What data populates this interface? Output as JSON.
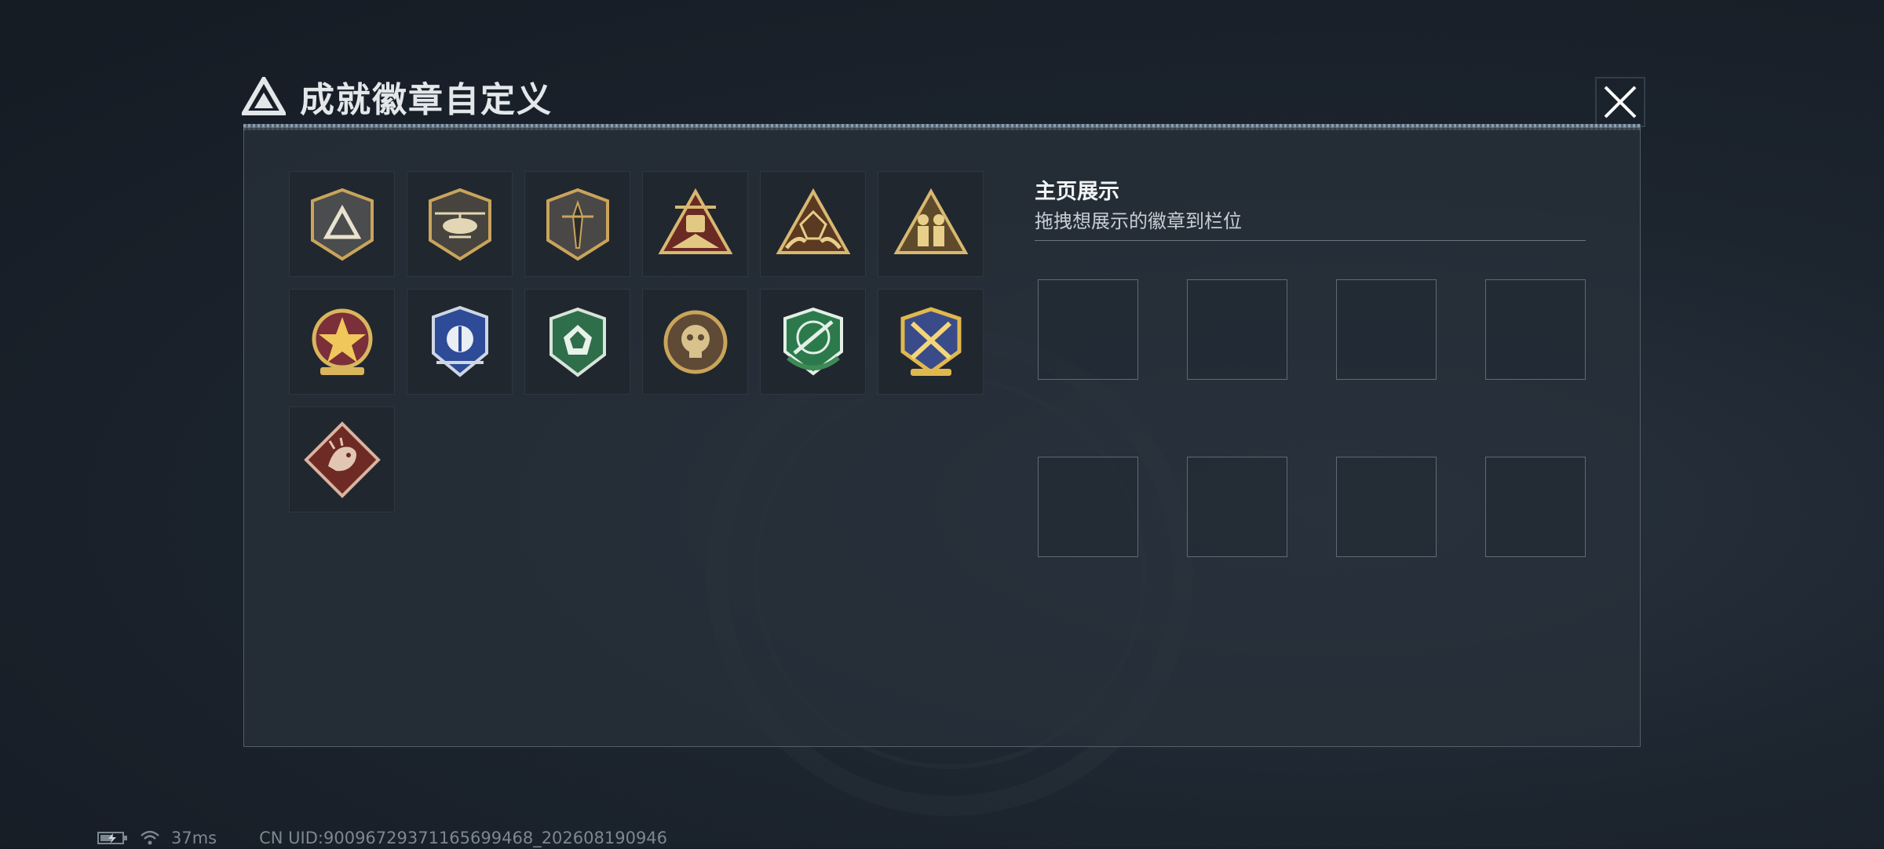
{
  "window": {
    "title": "成就徽章自定义",
    "title_icon": "delta-triangle-logo-icon",
    "close_icon": "close-icon"
  },
  "colors": {
    "accent_gold": "#c9a45a",
    "panel_border": "#aab9c8",
    "background": "#1c242e"
  },
  "badges": [
    {
      "icon": "delta-shield-badge-icon"
    },
    {
      "icon": "helicopter-shield-badge-icon"
    },
    {
      "icon": "dagger-shield-badge-icon"
    },
    {
      "icon": "ninety-triangle-badge-icon"
    },
    {
      "icon": "d20-hands-triangle-badge-icon"
    },
    {
      "icon": "soldiers-triangle-badge-icon"
    },
    {
      "icon": "star-medal-badge-icon"
    },
    {
      "icon": "blue-wing-shield-badge-icon"
    },
    {
      "icon": "green-gem-shield-badge-icon"
    },
    {
      "icon": "skull-round-badge-icon"
    },
    {
      "icon": "crosshair-rifle-badge-icon"
    },
    {
      "icon": "crossed-swords-gold-badge-icon"
    },
    {
      "icon": "dragon-diamond-badge-icon"
    }
  ],
  "showcase": {
    "title": "主页展示",
    "subtitle": "拖拽想展示的徽章到栏位",
    "slot_count": 8
  },
  "status": {
    "battery_icon": "battery-charging-icon",
    "wifi_icon": "wifi-icon",
    "ping": "37ms",
    "uid": "CN UID:9009672937116569946​8_202608190946"
  }
}
